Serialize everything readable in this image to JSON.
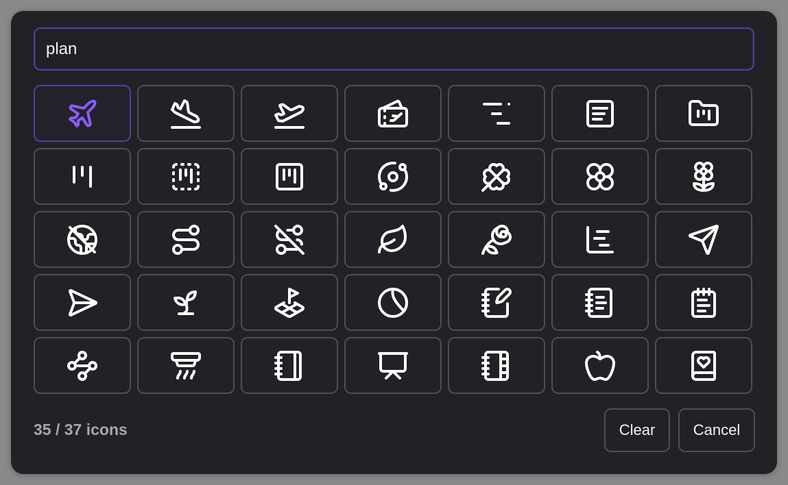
{
  "search": {
    "value": "plan"
  },
  "icons": [
    {
      "name": "plane-icon"
    },
    {
      "name": "plane-landing-icon"
    },
    {
      "name": "plane-takeoff-icon"
    },
    {
      "name": "tickets-plane-icon"
    },
    {
      "name": "text-align-end-icon"
    },
    {
      "name": "notepad-text-icon"
    },
    {
      "name": "folder-kanban-icon"
    },
    {
      "name": "kanban-icon"
    },
    {
      "name": "square-dashed-kanban-icon"
    },
    {
      "name": "square-kanban-icon"
    },
    {
      "name": "orbit-icon"
    },
    {
      "name": "clover-icon"
    },
    {
      "name": "flower-2-icon"
    },
    {
      "name": "flower-icon"
    },
    {
      "name": "earth-off-icon"
    },
    {
      "name": "route-icon"
    },
    {
      "name": "route-off-icon"
    },
    {
      "name": "leaf-icon"
    },
    {
      "name": "rose-icon"
    },
    {
      "name": "chart-gantt-icon"
    },
    {
      "name": "send-icon"
    },
    {
      "name": "send-horizontal-icon"
    },
    {
      "name": "sprout-icon"
    },
    {
      "name": "land-plot-icon"
    },
    {
      "name": "chart-pie-icon"
    },
    {
      "name": "notebook-pen-icon"
    },
    {
      "name": "notebook-text-icon"
    },
    {
      "name": "notepad-text-icon"
    },
    {
      "name": "waypoints-icon"
    },
    {
      "name": "alarm-smoke-icon"
    },
    {
      "name": "notebook-icon"
    },
    {
      "name": "presentation-icon"
    },
    {
      "name": "notebook-tabs-icon"
    },
    {
      "name": "apple-icon"
    },
    {
      "name": "book-heart-icon"
    }
  ],
  "footer": {
    "count": "35 / 37 icons",
    "clear_label": "Clear",
    "cancel_label": "Cancel"
  },
  "colors": {
    "accent": "#8b5cf6",
    "icon": "#ffffff",
    "border": "#4e4f54"
  }
}
